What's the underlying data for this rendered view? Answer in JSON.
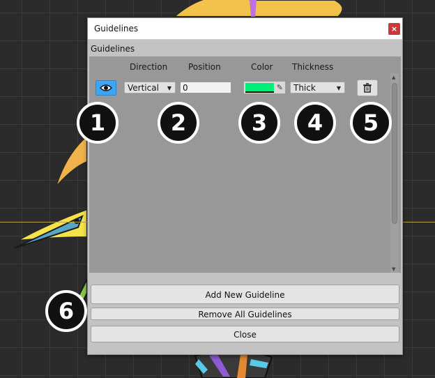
{
  "window": {
    "title": "Guidelines",
    "close_glyph": "×"
  },
  "section": {
    "label": "Guidelines"
  },
  "columns": {
    "direction": "Direction",
    "position": "Position",
    "color": "Color",
    "thickness": "Thickness"
  },
  "guideline": {
    "visibility_icon": "eye-icon",
    "direction": "Vertical",
    "position": "0",
    "color": "#00f078",
    "thickness": "Thick",
    "delete_icon": "trash-icon",
    "delete_glyph": "🗑"
  },
  "buttons": {
    "add": "Add New Guideline",
    "remove_all": "Remove All Guidelines",
    "close": "Close"
  },
  "badges": [
    "1",
    "2",
    "3",
    "4",
    "5",
    "6"
  ]
}
